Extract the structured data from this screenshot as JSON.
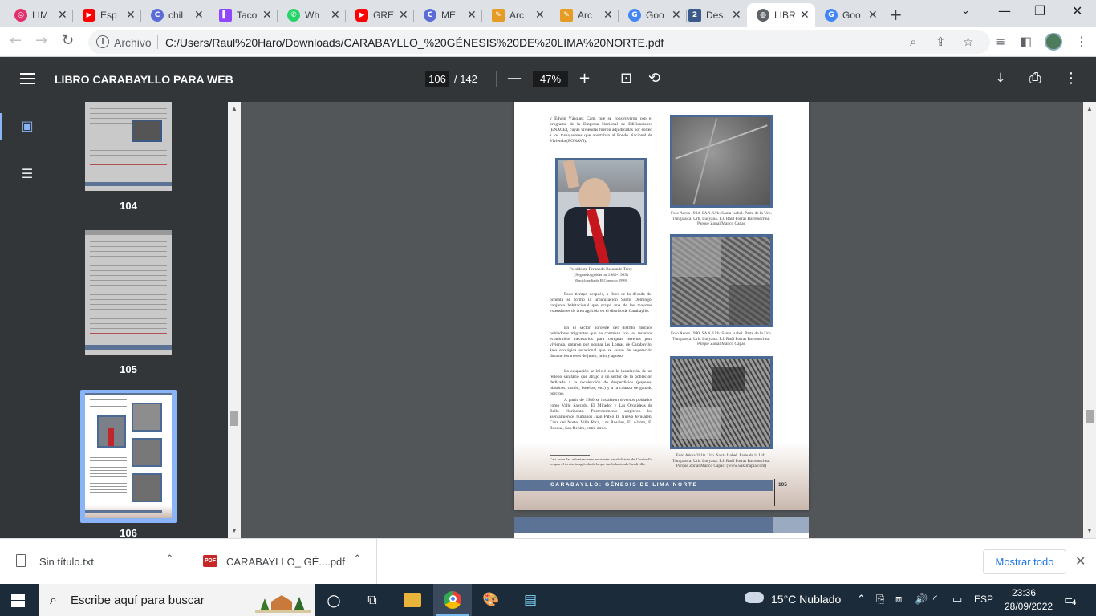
{
  "browser": {
    "tabs": [
      {
        "label": "LIM",
        "favicon": "instagram-icon",
        "color": "#e1306c"
      },
      {
        "label": "Esp",
        "favicon": "youtube-icon",
        "color": "#ff0000"
      },
      {
        "label": "chil",
        "favicon": "openai-icon",
        "color": "#5b6bd8"
      },
      {
        "label": "Taco",
        "favicon": "twitch-icon",
        "color": "#9146ff"
      },
      {
        "label": "Wh",
        "favicon": "whatsapp-icon",
        "color": "#25d366"
      },
      {
        "label": "GRE",
        "favicon": "youtube-icon",
        "color": "#ff0000"
      },
      {
        "label": "ME",
        "favicon": "openai-icon",
        "color": "#5b6bd8"
      },
      {
        "label": "Arc",
        "favicon": "draw-icon",
        "color": "#e69c24"
      },
      {
        "label": "Arc",
        "favicon": "draw-icon",
        "color": "#e69c24"
      },
      {
        "label": "Goo",
        "favicon": "google-icon",
        "color": "#4285f4"
      },
      {
        "label": "Des",
        "favicon": "download-tab-icon",
        "color": "#3b5a8a"
      },
      {
        "label": "LIBR",
        "favicon": "globe-icon",
        "color": "#5f6368"
      },
      {
        "label": "Goo",
        "favicon": "google-icon",
        "color": "#4285f4"
      }
    ],
    "active_tab_index": 11,
    "address": {
      "label": "Archivo",
      "url": "C:/Users/Raul%20Haro/Downloads/CARABAYLLO_%20GÉNESIS%20DE%20LIMA%20NORTE.pdf"
    }
  },
  "pdf": {
    "title": "LIBRO CARABAYLLO PARA WEB",
    "current_page": "106",
    "total_pages": "/ 142",
    "zoom": "47%",
    "thumbnails": [
      {
        "page": "104"
      },
      {
        "page": "105"
      },
      {
        "page": "106"
      }
    ],
    "content": {
      "intro_text": "y Edwin Vásquez Cam, que se construyeron con el programa de la Empresa Nacional de Edificaciones (ENACE), cuyas viviendas fueron adjudicadas por sorteo a los trabajadores que aportaban al Fondo Nacional de Vivienda (FONAVI).",
      "portrait_caption_1": "Presidente Fernando Belaúnde Terry",
      "portrait_caption_2": "(Segundo gobierno 1980-1985)",
      "portrait_caption_3": "(Enciclopedia de El Comercio 1999)",
      "body_1": "Poco tiempo después, a fines de la década del ochenta se formó la urbanización Santo Domingo, conjunto habitacional que ocupó una de las mayores extensiones de área agrícola en el distrito de Carabayllo.",
      "body_2": "En el sector noroeste del distrito muchos pobladores migrantes que no contaban con los recursos económicos necesarios para comprar terrenos para vivienda, optaron por ocupar las Lomas de Carabayllo, área ecológica estacional que se cubre de vegetación durante los meses de junio, julio y agosto.",
      "body_3": "La ocupación se inició con la instalación de un relleno sanitario que atrajo a un sector de la población dedicada a la recolección de desperdicios (papeles, plásticos, cartón, botellas, etc.) y a la crianza de ganado porcino.",
      "body_4": "A partir de 1980 se instalaron diversos poblados como Valle Sagrado, El Mirador y Las Orquídeas de Bello Horizonte. Posteriormente surgieron los asentamientos humanos Juan Pablo II, Nueva Jerusalén, Cruz del Norte, Villa Rica, Los Rosales, El Álamo, El Bosque, San Benito, entre otros.",
      "footnote": "Casi todas las urbanizaciones existentes en el distrito de Carabayllo ocupan el territorio agrícola de lo que fue la hacienda Caudivilla.",
      "aerial_caption_1": "Foto Aérea 1984. SAN. Urb. Santa Isabel. Parte de la Urb. Tungasuca. Urb. Lucyana. P.J. Raúl Porras Barrenechea. Parque Zonal Manco Capac",
      "aerial_caption_2": "Foto Aérea 1990. SAN. Urb. Santa Isabel. Parte de la Urb. Tungasuca. Urb. Lucyana. P.J. Raúl Porras Barrenechea. Parque Zonal Manco Capac",
      "aerial_caption_3": "Foto Aérea 2010. Urb. Santa Isabel. Parte de la Urb. Tungasuca. Urb. Lucyana. P.J. Raúl Porras Barrenechea. Parque Zonal Manco Capac. (www.wikimapia.com)",
      "footer": "CARABAYLLO: GÉNESIS DE LIMA NORTE",
      "page_number": "105"
    }
  },
  "downloads": {
    "items": [
      {
        "name": "Sin título.txt",
        "icon": "text-file-icon"
      },
      {
        "name": "CARABAYLLO_ GÉ....pdf",
        "icon": "pdf-file-icon"
      }
    ],
    "show_all": "Mostrar todo"
  },
  "taskbar": {
    "search_placeholder": "Escribe aquí para buscar",
    "weather": "15°C  Nublado",
    "language": "ESP",
    "time": "23:36",
    "date": "28/09/2022",
    "notifications": "4"
  },
  "colors": {
    "pdf_toolbar": "#323639",
    "pdf_background": "#525659",
    "accent_blue": "#8ab4f8",
    "footer_band": "#5c7395",
    "taskbar": "#1c2b3a"
  }
}
